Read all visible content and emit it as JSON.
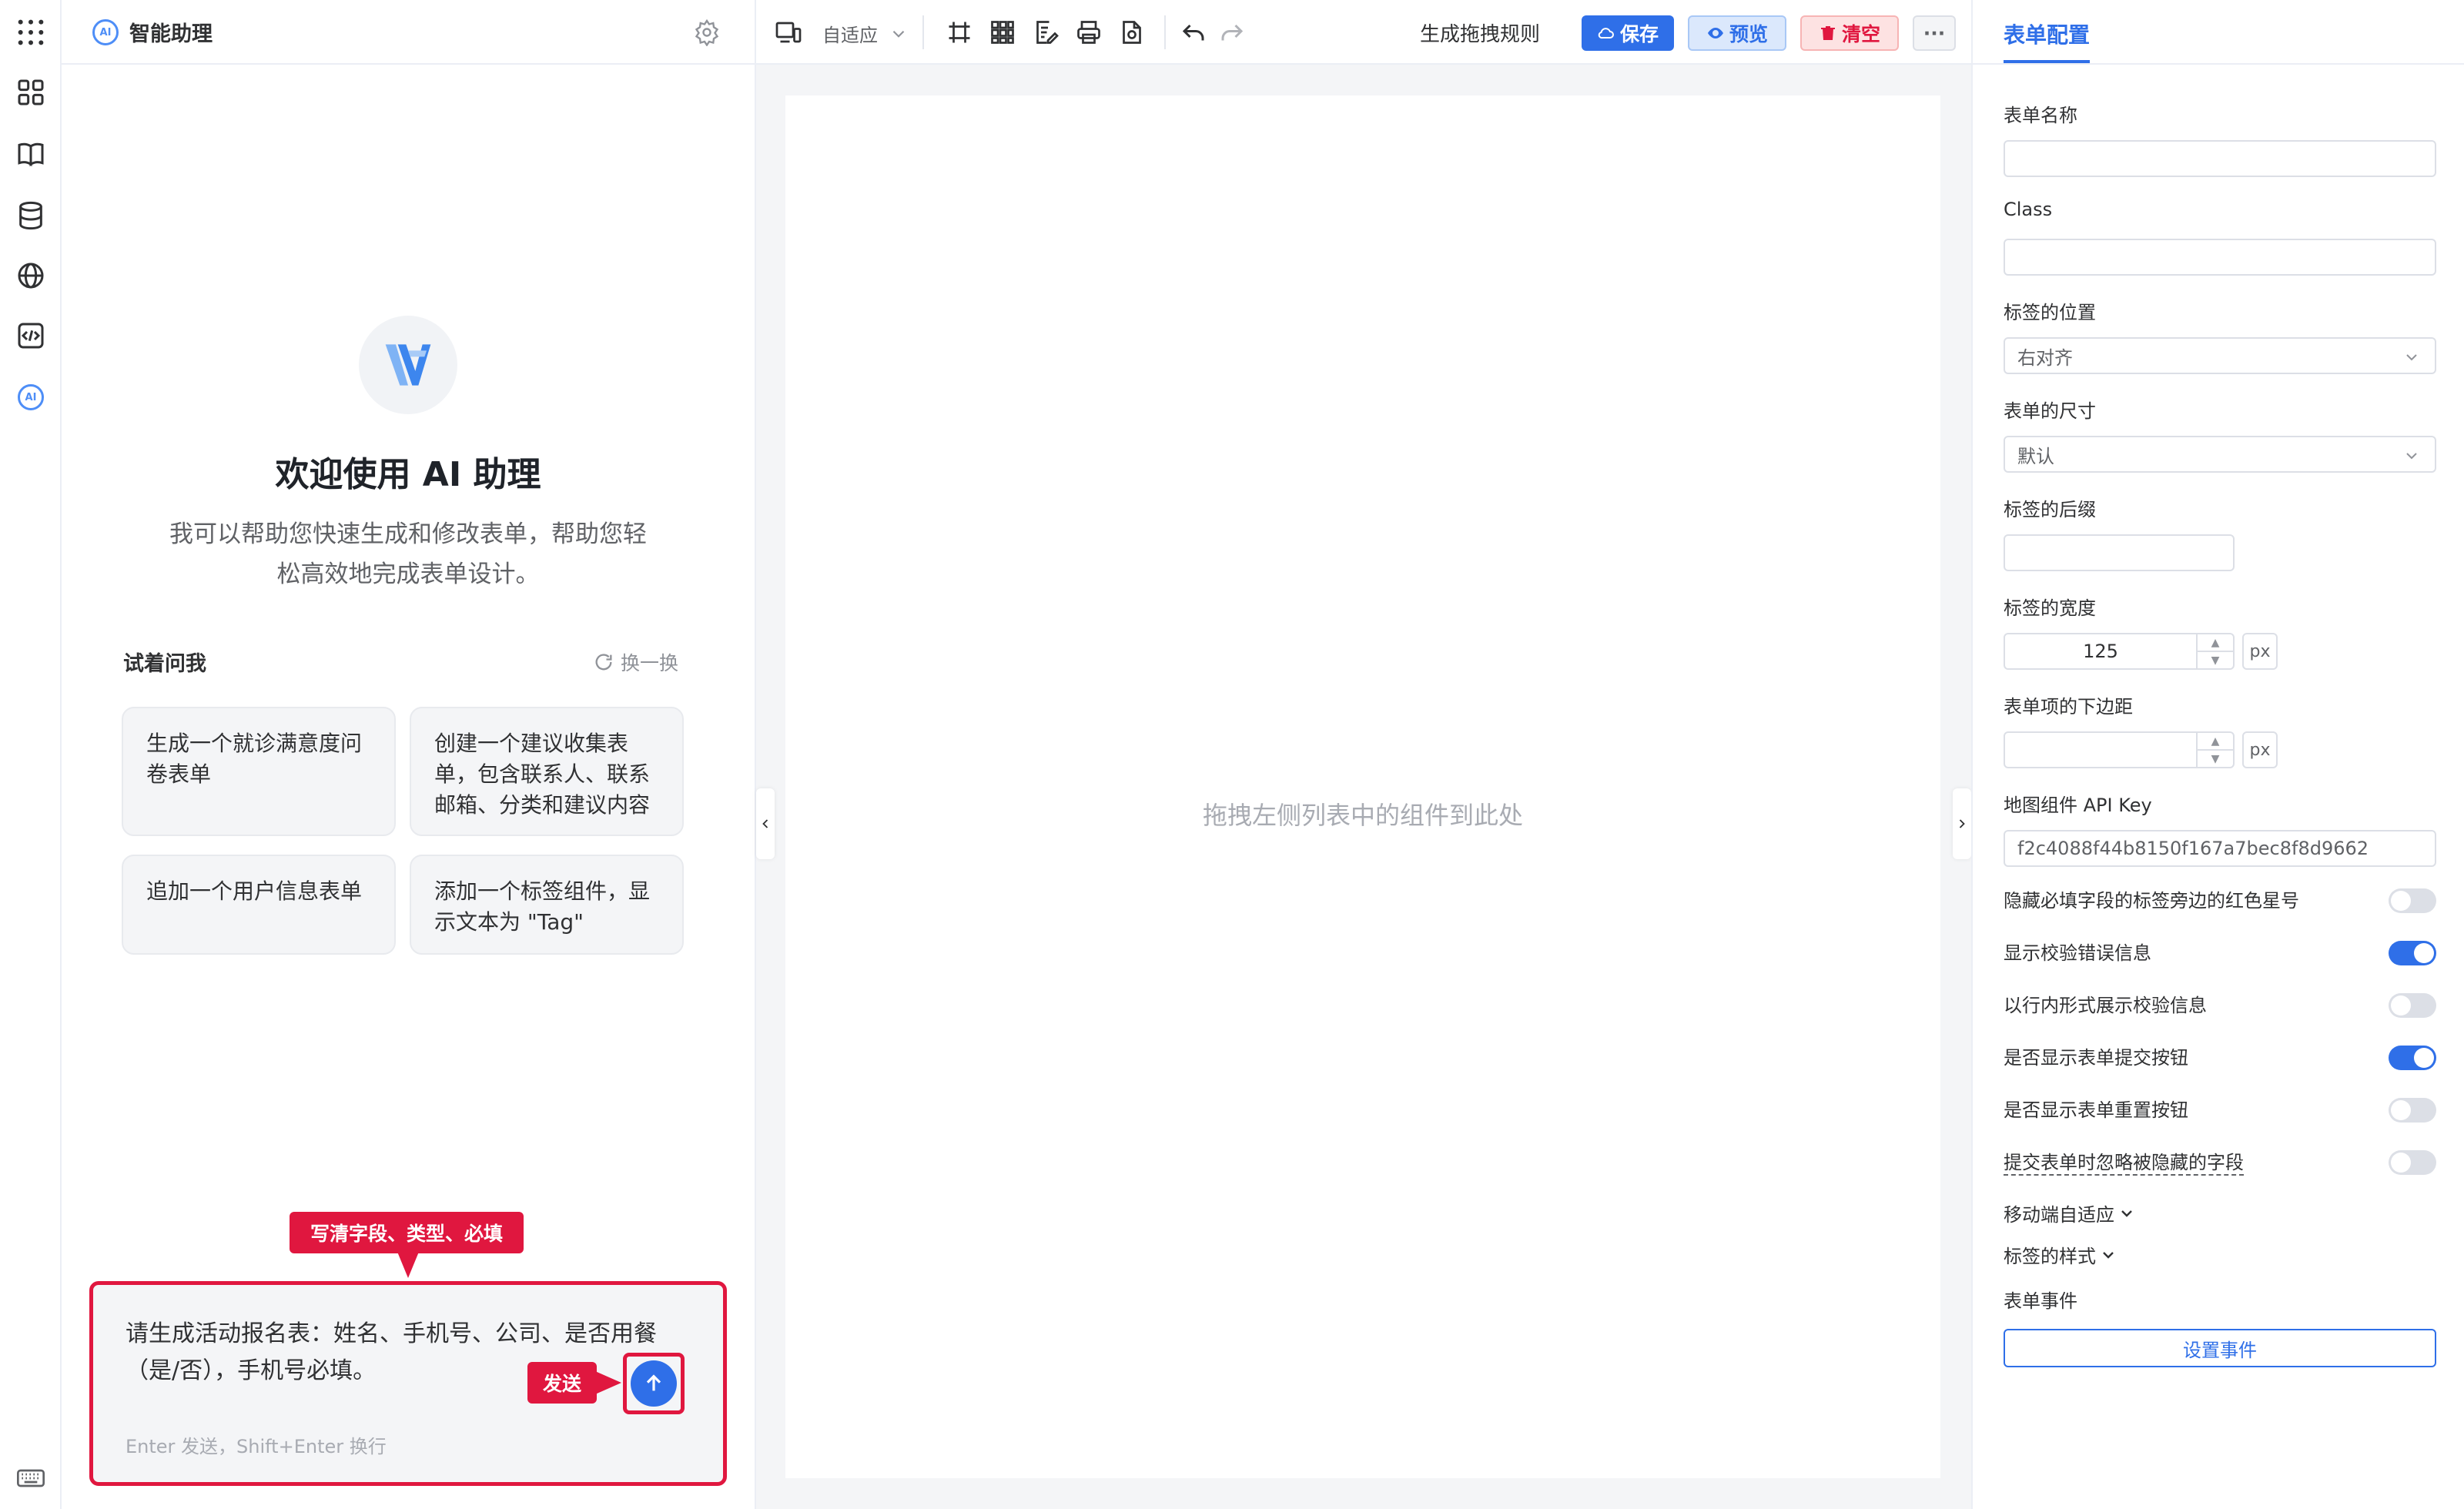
{
  "ai_panel": {
    "title": "智能助理",
    "badge": "AI",
    "welcome": "欢迎使用 AI 助理",
    "intro": "我可以帮助您快速生成和修改表单，帮助您轻松高效地完成表单设计。",
    "try_ask": "试着问我",
    "refresh": "换一换",
    "suggestions": [
      "生成一个就诊满意度问卷表单",
      "创建一个建议收集表单，包含联系人、联系邮箱、分类和建议内容",
      "追加一个用户信息表单",
      "添加一个标签组件，显示文本为 \"Tag\""
    ],
    "input_text": "请生成活动报名表：姓名、手机号、公司、是否用餐（是/否），手机号必填。",
    "input_hint": "Enter 发送，Shift+Enter 换行",
    "callout_top": "写清字段、类型、必填",
    "callout_send": "发送"
  },
  "toolbar": {
    "device_mode": "自适应",
    "generate_rules": "生成拖拽规则",
    "save": "保存",
    "preview": "预览",
    "clear": "清空",
    "more": "···"
  },
  "canvas": {
    "empty_text": "拖拽左侧列表中的组件到此处"
  },
  "config": {
    "tab": "表单配置",
    "form_name_label": "表单名称",
    "form_name_value": "",
    "class_label": "Class",
    "class_value": "",
    "label_position_label": "标签的位置",
    "label_position_value": "右对齐",
    "form_size_label": "表单的尺寸",
    "form_size_value": "默认",
    "label_suffix_label": "标签的后缀",
    "label_suffix_value": "",
    "label_width_label": "标签的宽度",
    "label_width_value": "125",
    "unit": "px",
    "item_margin_label": "表单项的下边距",
    "item_margin_value": "",
    "map_key_label": "地图组件 API Key",
    "map_key_value": "f2c4088f44b8150f167a7bec8f8d9662",
    "switches": [
      {
        "label": "隐藏必填字段的标签旁边的红色星号",
        "on": false
      },
      {
        "label": "显示校验错误信息",
        "on": true
      },
      {
        "label": "以行内形式展示校验信息",
        "on": false
      },
      {
        "label": "是否显示表单提交按钮",
        "on": true
      },
      {
        "label": "是否显示表单重置按钮",
        "on": false
      },
      {
        "label": "提交表单时忽略被隐藏的字段",
        "on": false
      }
    ],
    "mobile_adapt": "移动端自适应",
    "label_style": "标签的样式",
    "form_events_label": "表单事件",
    "set_event": "设置事件"
  },
  "colors": {
    "accent": "#2f6fe8",
    "danger": "#e0173f",
    "save_bg": "#2f6fe8",
    "preview_bg": "#dbe8fc",
    "clear_bg": "#fde2e2"
  }
}
